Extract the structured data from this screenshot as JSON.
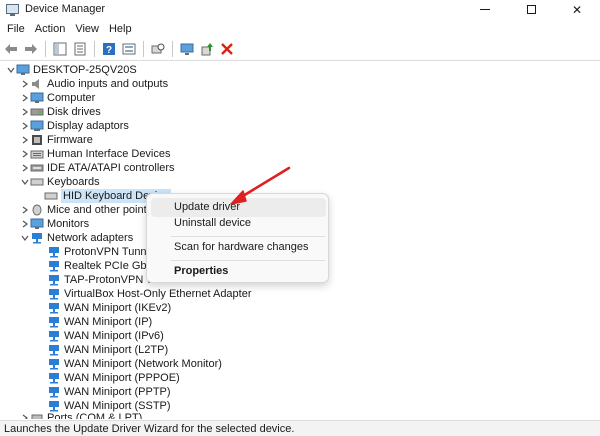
{
  "window": {
    "title": "Device Manager"
  },
  "controls": {
    "minimize": "–",
    "close": "✕"
  },
  "menubar": {
    "items": [
      "File",
      "Action",
      "View",
      "Help"
    ]
  },
  "toolbar": {
    "buttons": [
      "back-icon",
      "forward-icon",
      "show-hide-console-tree-icon",
      "properties-icon",
      "help-icon",
      "view-icon",
      "scan-hardware-icon",
      "monitor-icon",
      "update-driver-icon",
      "uninstall-icon"
    ],
    "uninstall_color": "#d9230f",
    "update_color": "#2f8f2f"
  },
  "tree": {
    "root": "DESKTOP-25QV20S",
    "categories": {
      "audio": "Audio inputs and outputs",
      "computer": "Computer",
      "disk": "Disk drives",
      "display": "Display adaptors",
      "firmware": "Firmware",
      "hid": "Human Interface Devices",
      "ide": "IDE ATA/ATAPI controllers",
      "keyboards": "Keyboards",
      "keyboard_device": "HID Keyboard Device",
      "mice": "Mice and other pointing",
      "monitors": "Monitors",
      "network": "Network adapters",
      "ports": "Ports (COM & LPT)"
    },
    "network_devices": [
      "ProtonVPN Tunnel",
      "Realtek PCIe GbE Fa",
      "TAP-ProtonVPN Wir",
      "VirtualBox Host-Only Ethernet Adapter",
      "WAN Miniport (IKEv2)",
      "WAN Miniport (IP)",
      "WAN Miniport (IPv6)",
      "WAN Miniport (L2TP)",
      "WAN Miniport (Network Monitor)",
      "WAN Miniport (PPPOE)",
      "WAN Miniport (PPTP)",
      "WAN Miniport (SSTP)"
    ]
  },
  "context_menu": {
    "update_driver": "Update driver",
    "uninstall_device": "Uninstall device",
    "scan": "Scan for hardware changes",
    "properties": "Properties"
  },
  "status": {
    "text": "Launches the Update Driver Wizard for the selected device."
  },
  "colors": {
    "accent_arrow": "#e02020",
    "selection": "#cce4f7",
    "network_icon": "#2a7fd4"
  }
}
